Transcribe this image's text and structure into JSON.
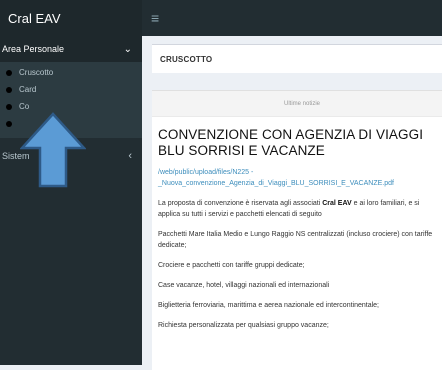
{
  "header": {
    "brand": "Cral EAV",
    "menu_icon": "≡"
  },
  "sidebar": {
    "section_label": "Area Personale",
    "section_chevron": "⌄",
    "items": [
      {
        "label": "Cruscotto"
      },
      {
        "label": "Card"
      },
      {
        "label": "Co"
      },
      {
        "label": ""
      }
    ],
    "system_label": "Sistem",
    "system_chevron": "‹"
  },
  "main": {
    "breadcrumb": "CRUSCOTTO",
    "card_header": "Ultime notizie",
    "news": {
      "title": "CONVENZIONE CON AGENZIA DI VIAGGI BLU SORRISI E VACANZE",
      "link": "/web/public/upload/files/N225 - _Nuova_convenzione_Agenzia_di_Viaggi_BLU_SORRISI_E_VACANZE.pdf",
      "intro_pre": "La proposta di convenzione è riservata agli associati ",
      "intro_bold": "Cral EAV",
      "intro_post": " e ai loro familiari, e si applica su tutti i servizi e pacchetti elencati di seguito",
      "paragraphs": [
        " Pacchetti Mare Italia Medio e Lungo Raggio NS centralizzati (incluso crociere) con tariffe dedicate;",
        "Crociere e pacchetti con tariffe gruppi dedicate;",
        "Case vacanze, hotel, villaggi nazionali ed internazionali",
        "Biglietteria ferroviaria, marittima e aerea nazionale ed intercontinentale;",
        "Richiesta personalizzata per qualsiasi gruppo vacanze;"
      ]
    }
  },
  "colors": {
    "sidebar_bg": "#222d32",
    "sidebar_header_bg": "#1e282c",
    "link": "#3c8dbc",
    "arrow_fill": "#5b9bd5",
    "arrow_stroke": "#2e5a87"
  }
}
